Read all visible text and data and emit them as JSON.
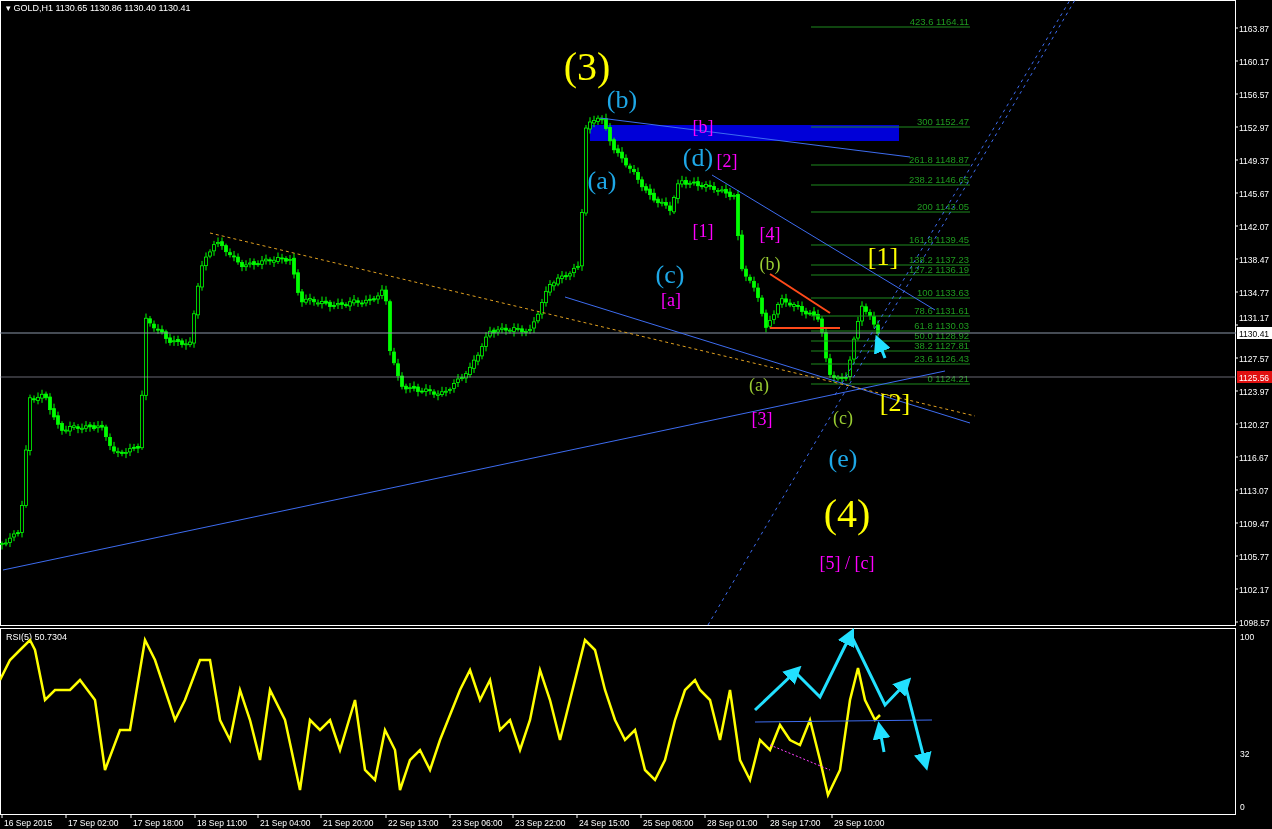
{
  "chart": {
    "header": "▾ GOLD,H1 1130.65 1130.86 1130.40 1130.41",
    "wave_labels": [
      {
        "text": "(3)",
        "color": "#ffff00",
        "kind": "major"
      },
      {
        "text": "(b)",
        "color": "#1ea7e6",
        "kind": "minor"
      },
      {
        "text": "[b]",
        "color": "#ff00ff",
        "kind": "sub"
      },
      {
        "text": "(d)",
        "color": "#1ea7e6",
        "kind": "minor"
      },
      {
        "text": "[2]",
        "color": "#ff00ff",
        "kind": "sub"
      },
      {
        "text": "(a)",
        "color": "#1ea7e6",
        "kind": "minor"
      },
      {
        "text": "[1]",
        "color": "#ff00ff",
        "kind": "sub"
      },
      {
        "text": "[4]",
        "color": "#ff00ff",
        "kind": "sub"
      },
      {
        "text": "(b)",
        "color": "#9acd32",
        "kind": "sub"
      },
      {
        "text": "[1]",
        "color": "#ffff00",
        "kind": "minor"
      },
      {
        "text": "(c)",
        "color": "#1ea7e6",
        "kind": "minor"
      },
      {
        "text": "[a]",
        "color": "#ff00ff",
        "kind": "sub"
      },
      {
        "text": "(a)",
        "color": "#9acd32",
        "kind": "sub"
      },
      {
        "text": "[2]",
        "color": "#ffff00",
        "kind": "minor"
      },
      {
        "text": "[3]",
        "color": "#ff00ff",
        "kind": "sub"
      },
      {
        "text": "(c)",
        "color": "#9acd32",
        "kind": "sub"
      },
      {
        "text": "(e)",
        "color": "#1ea7e6",
        "kind": "minor"
      },
      {
        "text": "(4)",
        "color": "#ffff00",
        "kind": "major"
      },
      {
        "text": "[5] / [c]",
        "color": "#ff00ff",
        "kind": "sub"
      }
    ],
    "fibonacci_levels": [
      "423.6 1164.11",
      "300 1152.47",
      "261.8 1148.87",
      "238.2 1146.65",
      "200 1143.05",
      "161.8 1139.45",
      "138.2 1137.23",
      "127.2 1136.19",
      "100 1133.63",
      "78.6 1131.61",
      "61.8 1130.03",
      "50.0 1128.92",
      "38.2 1127.81",
      "23.6 1126.43",
      "0 1124.21"
    ],
    "price_axis": {
      "labels": [
        "1163.87",
        "1160.17",
        "1156.57",
        "1152.97",
        "1149.37",
        "1145.67",
        "1142.07",
        "1138.47",
        "1134.77",
        "1131.17",
        "1127.57",
        "1123.97",
        "1120.27",
        "1116.67",
        "1113.07",
        "1109.47",
        "1105.77",
        "1102.17",
        "1098.57"
      ],
      "current_price": "1130.41",
      "marked_price": "1125.56"
    }
  },
  "rsi": {
    "title": "RSI(5) 50.7304",
    "axis_labels": [
      "100",
      "32",
      "0"
    ]
  },
  "time_axis": {
    "labels": [
      "16 Sep 2015",
      "17 Sep 02:00",
      "17 Sep 18:00",
      "18 Sep 11:00",
      "21 Sep 04:00",
      "21 Sep 20:00",
      "22 Sep 13:00",
      "23 Sep 06:00",
      "23 Sep 22:00",
      "24 Sep 15:00",
      "25 Sep 08:00",
      "28 Sep 01:00",
      "28 Sep 17:00",
      "29 Sep 10:00"
    ]
  }
}
